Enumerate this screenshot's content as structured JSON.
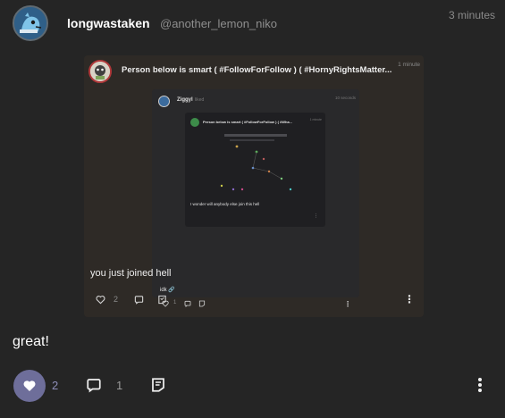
{
  "post": {
    "username": "longwastaken",
    "handle": "@another_lemon_niko",
    "time": "3 minutes",
    "text": "great!",
    "like_count": "2",
    "comment_count": "1",
    "liked": true
  },
  "quoted": {
    "title": "Person below is smart ( #FollowForFollow ) ( #HornyRightsMatter...",
    "time": "1 minute",
    "text": "you just joined hell",
    "like_count": "2"
  },
  "quoted_inner": {
    "username": "Ziggyl",
    "handle": "liked",
    "time": "10 seconds",
    "text": "idk",
    "like_count": "1"
  },
  "quoted_inner2": {
    "title": "Person below is smart ( #FollowForFollow ) ( #Wha...",
    "time": "1 minute",
    "text": "I wonder will anybody else join this hell"
  },
  "colors": {
    "like_active": "#6e6e9a",
    "background": "#252525",
    "quote_bg": "#2e2a26"
  }
}
